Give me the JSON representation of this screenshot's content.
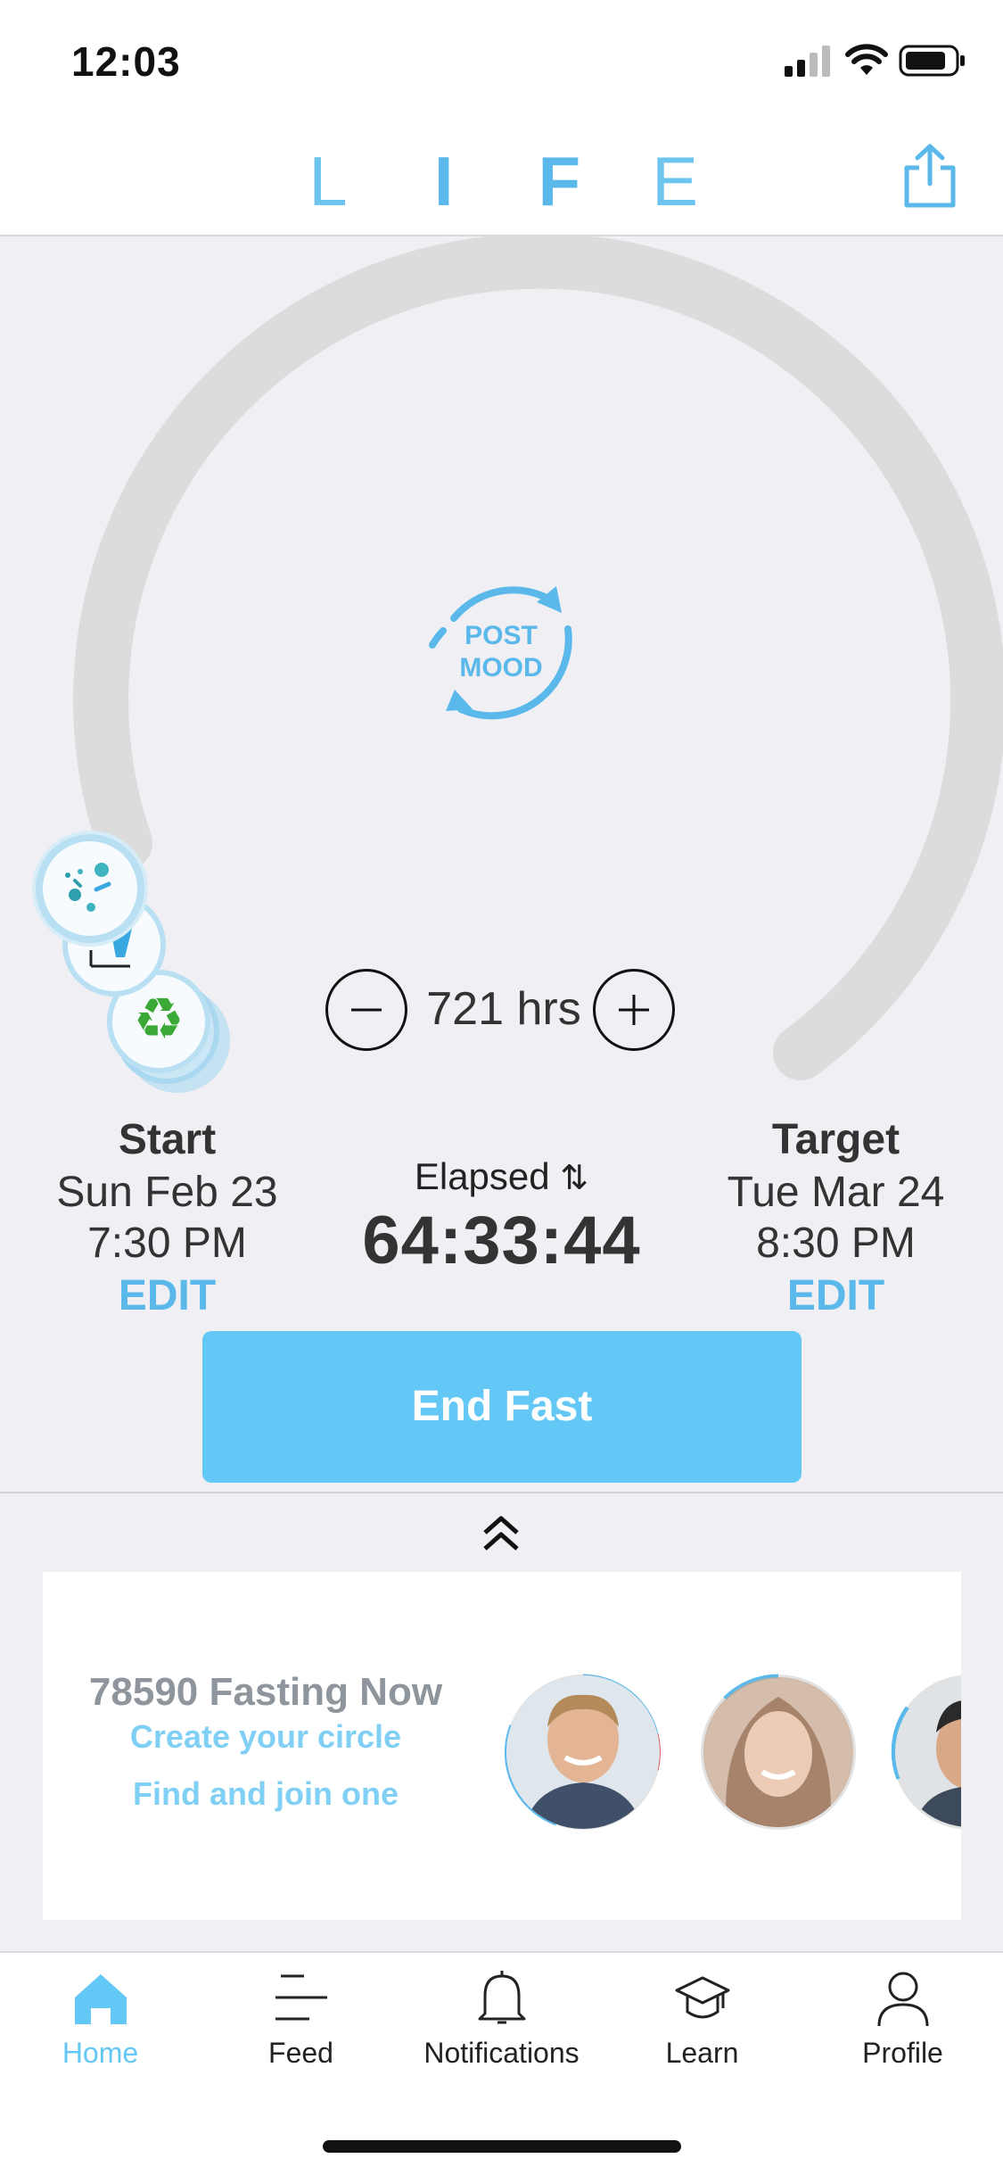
{
  "status_bar": {
    "time": "12:03"
  },
  "header": {
    "logo_letters": [
      "L",
      "I",
      "F",
      "E"
    ]
  },
  "timer": {
    "post_mood_line1": "POST",
    "post_mood_line2": "MOOD",
    "hours_label": "721 hrs",
    "start": {
      "heading": "Start",
      "date": "Sun Feb 23",
      "time": "7:30 PM",
      "edit": "EDIT"
    },
    "elapsed": {
      "label": "Elapsed",
      "value": "64:33:44"
    },
    "target": {
      "heading": "Target",
      "date": "Tue Mar 24",
      "time": "8:30 PM",
      "edit": "EDIT"
    },
    "end_button": "End Fast"
  },
  "community": {
    "fasting_now": "78590 Fasting Now",
    "create_circle": "Create your circle",
    "find_join": "Find and join one"
  },
  "tabbar": {
    "items": [
      {
        "label": "Home",
        "icon": "home-icon",
        "active": true
      },
      {
        "label": "Feed",
        "icon": "feed-icon",
        "active": false
      },
      {
        "label": "Notifications",
        "icon": "bell-icon",
        "active": false
      },
      {
        "label": "Learn",
        "icon": "graduation-cap-icon",
        "active": false
      },
      {
        "label": "Profile",
        "icon": "person-icon",
        "active": false
      }
    ]
  },
  "colors": {
    "accent": "#5ab9ea",
    "button": "#63c8f5",
    "background": "#efeff4",
    "arc": "#dcdcdc"
  }
}
